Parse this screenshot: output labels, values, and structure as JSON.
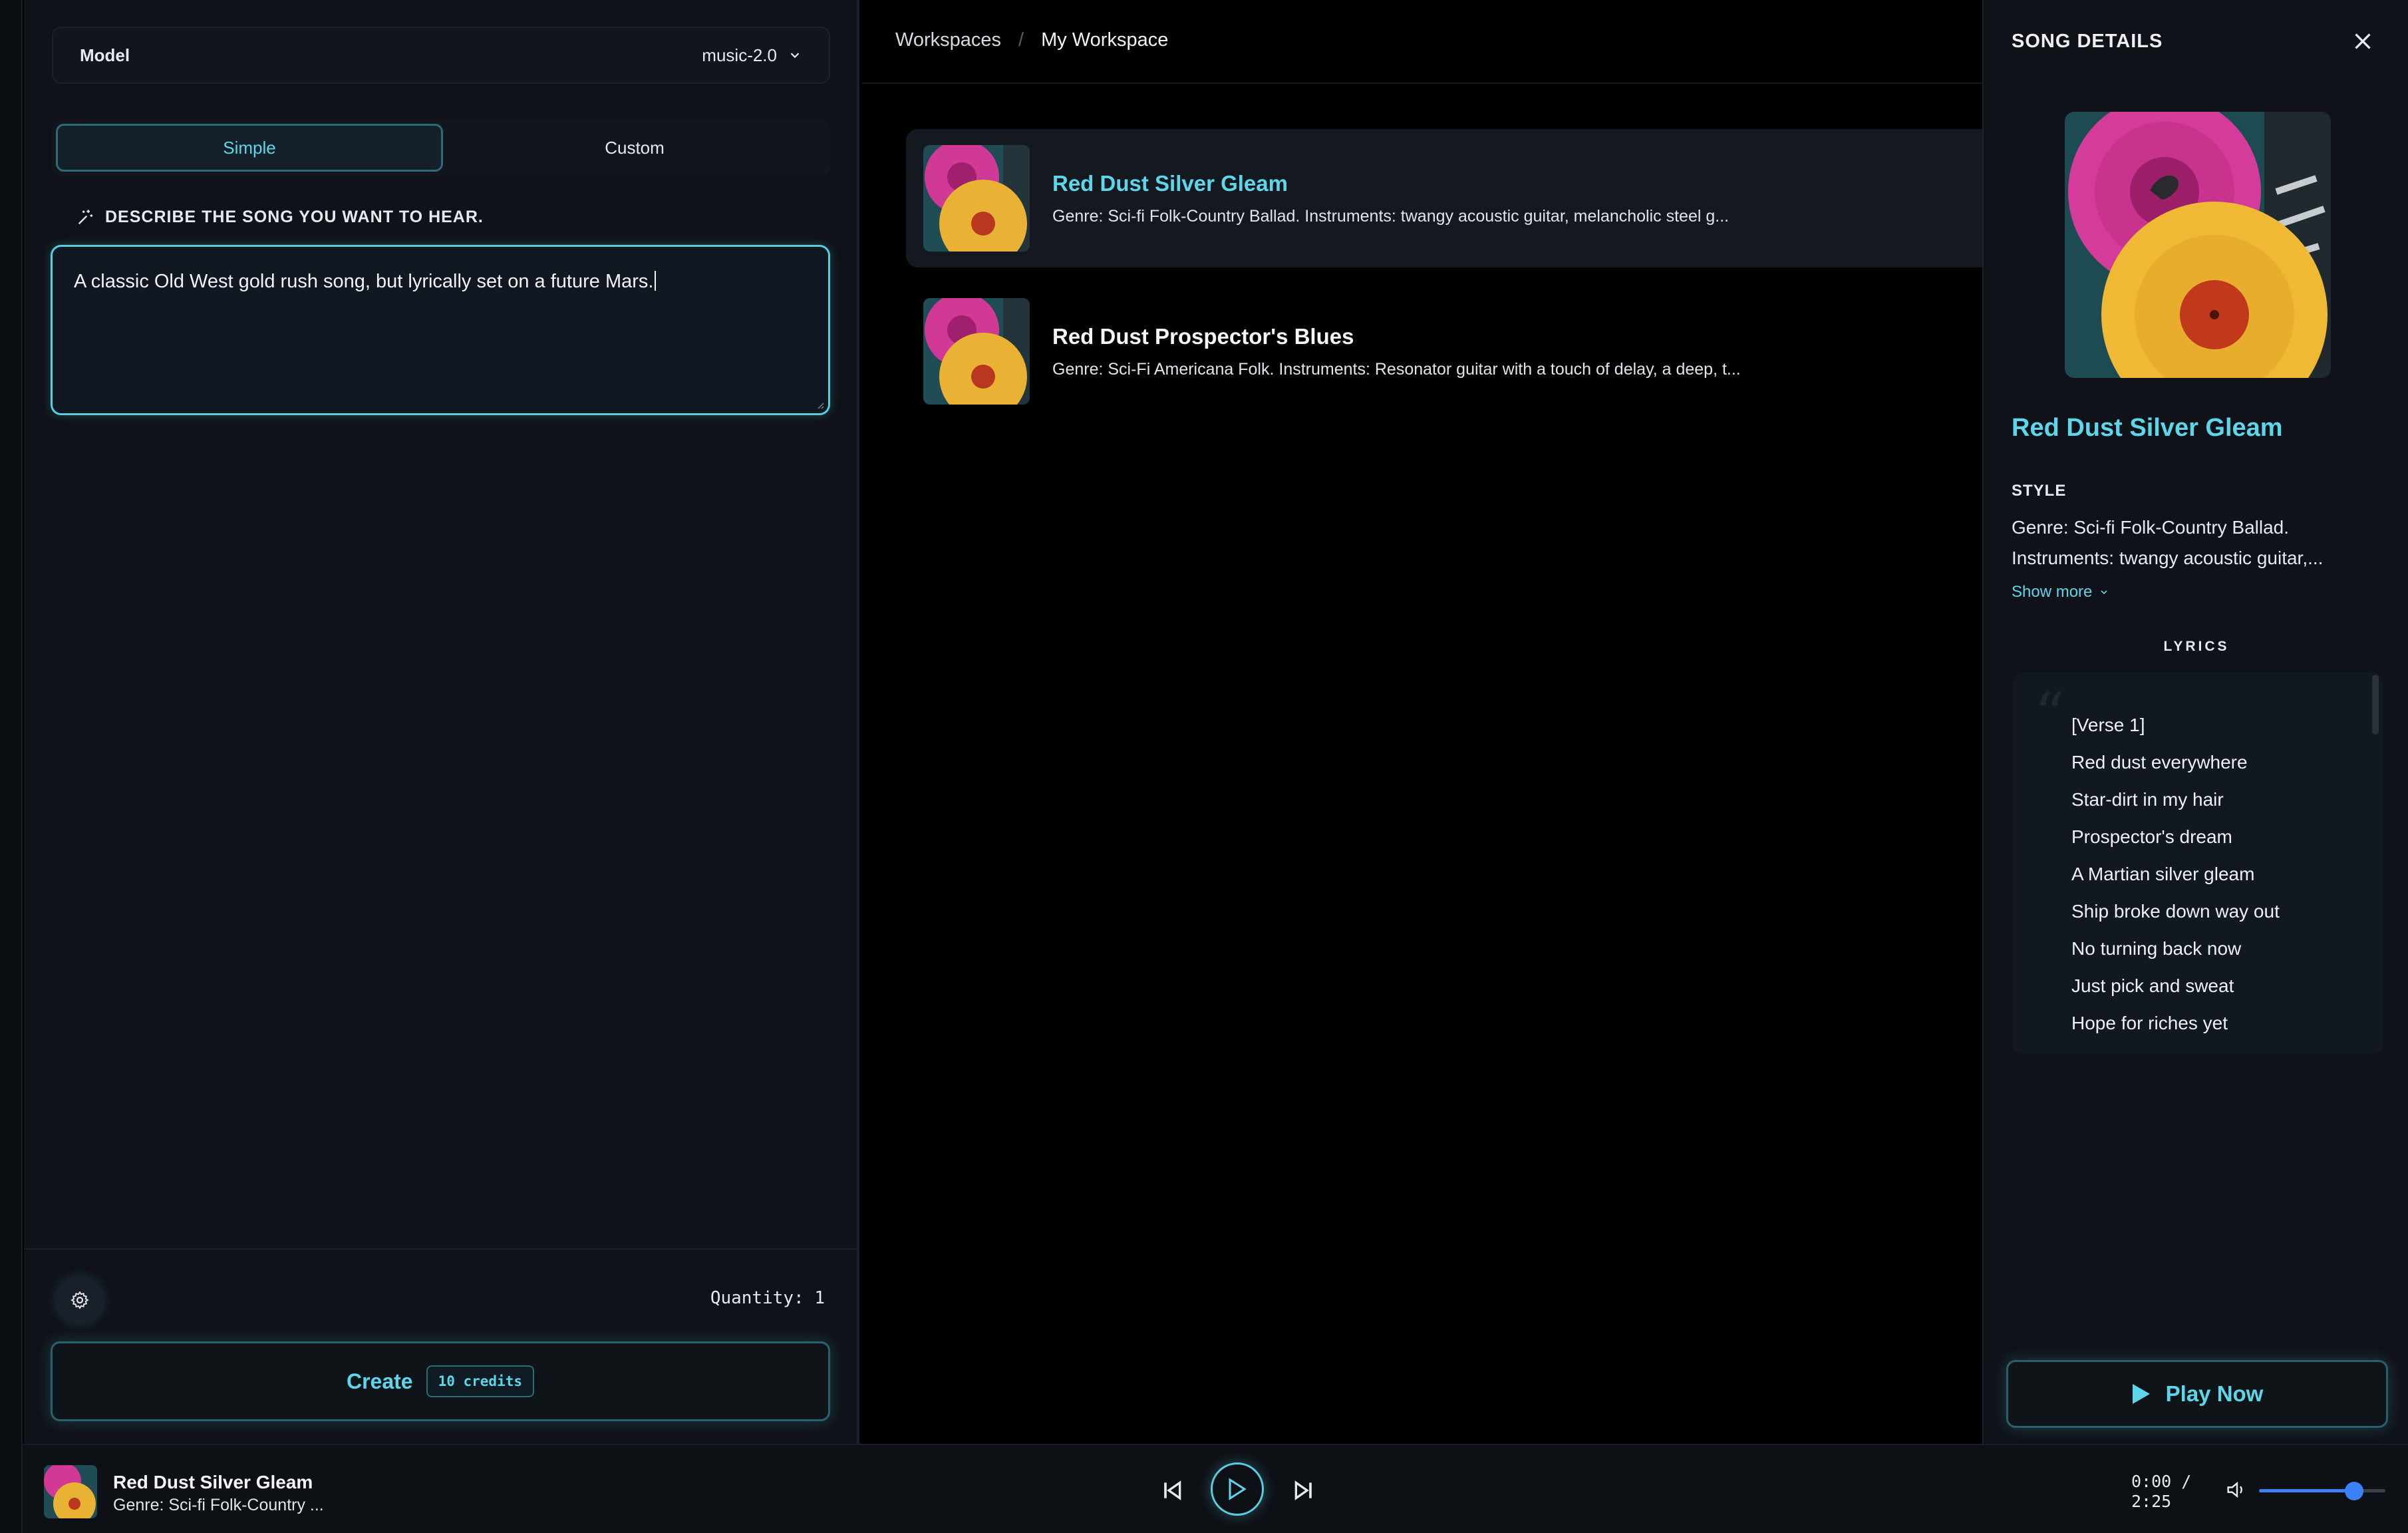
{
  "left": {
    "model_label": "Model",
    "model_value": "music-2.0",
    "tabs": [
      {
        "label": "Simple",
        "active": true
      },
      {
        "label": "Custom",
        "active": false
      }
    ],
    "describe_label": "DESCRIBE THE SONG YOU WANT TO HEAR.",
    "prompt_value": "A classic Old West gold rush song, but lyrically set on a future Mars.",
    "quantity": "Quantity: 1",
    "create_label": "Create",
    "credits": "10 credits"
  },
  "breadcrumb": [
    "Workspaces",
    "My Workspace"
  ],
  "songs": [
    {
      "title": "Red Dust Silver Gleam",
      "desc": "Genre: Sci-fi Folk-Country Ballad. Instruments: twangy acoustic guitar, melancholic steel g...",
      "selected": true
    },
    {
      "title": "Red Dust Prospector's Blues",
      "desc": "Genre: Sci-Fi Americana Folk. Instruments: Resonator guitar with a touch of delay, a deep, t...",
      "selected": false
    }
  ],
  "details": {
    "heading": "SONG DETAILS",
    "title": "Red Dust Silver Gleam",
    "style_label": "STYLE",
    "style_line1": "Genre: Sci-fi Folk-Country Ballad.",
    "style_line2": "Instruments: twangy acoustic guitar,...",
    "show_more": "Show more",
    "lyrics_label": "LYRICS",
    "lyrics": [
      "[Verse 1]",
      "Red dust everywhere",
      "Star-dirt in my hair",
      "Prospector's dream",
      "A Martian silver gleam",
      "Ship broke down way out",
      "No turning back now",
      "Just pick and sweat",
      "Hope for riches yet"
    ],
    "play_now": "Play Now"
  },
  "player": {
    "title": "Red Dust Silver Gleam",
    "subtitle": "Genre: Sci-fi Folk-Country ...",
    "time_current": "0:00 /",
    "time_total": "2:25",
    "volume": 0.75
  },
  "colors": {
    "accent": "#5ed6ea",
    "volume": "#3b82f6",
    "background": "#000000",
    "panel": "#0f1319"
  }
}
